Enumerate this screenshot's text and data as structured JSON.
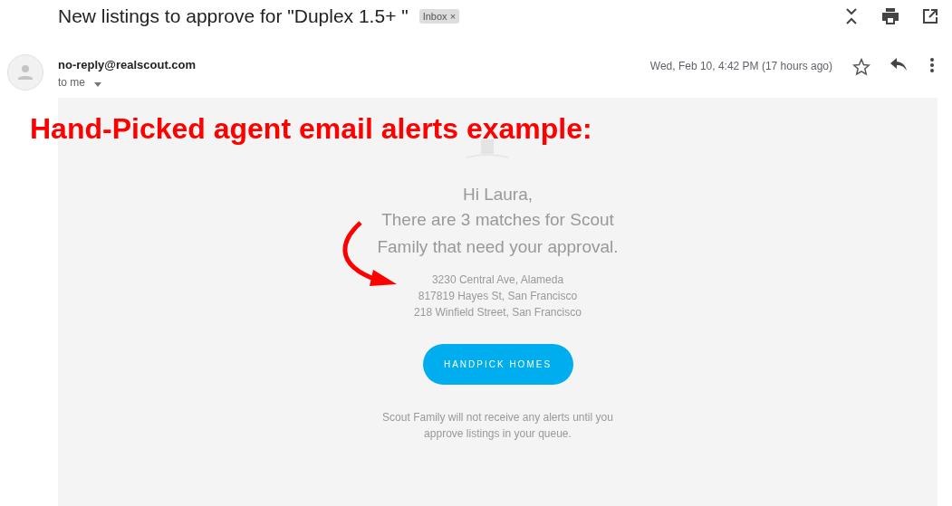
{
  "subject": "New listings to approve for \"Duplex 1.5+ \"",
  "label": {
    "text": "Inbox",
    "remove": "×"
  },
  "sender": {
    "address": "no-reply@realscout.com",
    "recipient": "to me",
    "date": "Wed, Feb 10, 4:42 PM (17 hours ago)",
    "starred": false
  },
  "annotation": "Hand-Picked agent email alerts example:",
  "body": {
    "greeting": "Hi Laura,",
    "message": "There are 3 matches for Scout Family that need your approval.",
    "addresses": [
      "3230 Central Ave, Alameda",
      "817819 Hayes St, San Francisco",
      "218 Winfield Street, San Francisco"
    ],
    "button": "HANDPICK HOMES",
    "footer": "Scout Family will not receive any alerts until you approve listings in your queue."
  }
}
